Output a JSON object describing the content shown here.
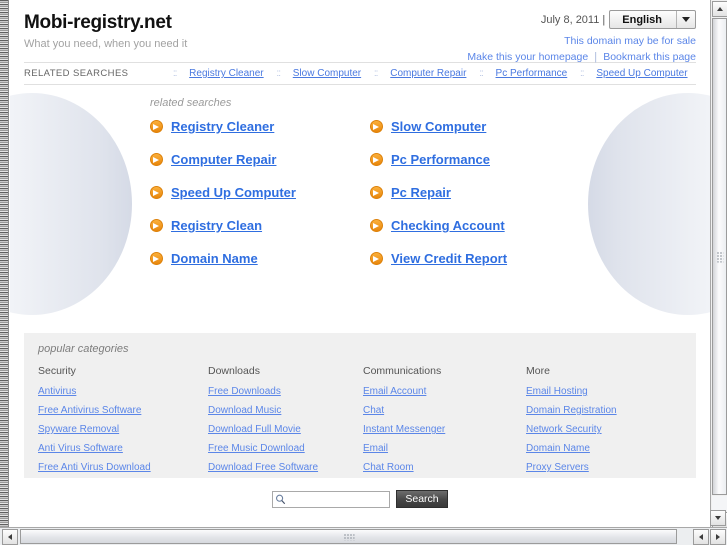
{
  "header": {
    "site_title": "Mobi-registry.net",
    "tagline": "What you need, when you need it",
    "date": "July 8, 2011 |",
    "language": "English",
    "for_sale_link": "This domain may be for sale",
    "homepage_link": "Make this your homepage",
    "pipe": "|",
    "bookmark_link": "Bookmark this page"
  },
  "related_strip": {
    "label": "RELATED SEARCHES",
    "dots": "::",
    "items": [
      "Registry Cleaner",
      "Slow Computer",
      "Computer Repair",
      "Pc Performance",
      "Speed Up Computer"
    ]
  },
  "main": {
    "heading": "related searches",
    "links": [
      "Registry Cleaner",
      "Slow Computer",
      "Computer Repair",
      "Pc Performance",
      "Speed Up Computer",
      "Pc Repair",
      "Registry Clean",
      "Checking Account",
      "Domain Name",
      "View Credit Report"
    ]
  },
  "categories": {
    "heading": "popular categories",
    "columns": [
      {
        "title": "Security",
        "links": [
          "Antivirus",
          "Free Antivirus Software",
          "Spyware Removal",
          "Anti Virus Software",
          "Free Anti Virus Download"
        ]
      },
      {
        "title": "Downloads",
        "links": [
          "Free Downloads",
          "Download Music",
          "Download Full Movie",
          "Free Music Download",
          "Download Free Software"
        ]
      },
      {
        "title": "Communications",
        "links": [
          "Email Account",
          "Chat",
          "Instant Messenger",
          "Email",
          "Chat Room"
        ]
      },
      {
        "title": "More",
        "links": [
          "Email Hosting",
          "Domain Registration",
          "Network Security",
          "Domain Name",
          "Proxy Servers"
        ]
      }
    ]
  },
  "search": {
    "value": "",
    "placeholder": "",
    "button_label": "Search"
  },
  "colors": {
    "link_blue": "#5b86e8",
    "big_link_blue": "#2f6ee0",
    "accent_orange": "#e8860c",
    "panel_gray": "#f0f0f0"
  }
}
